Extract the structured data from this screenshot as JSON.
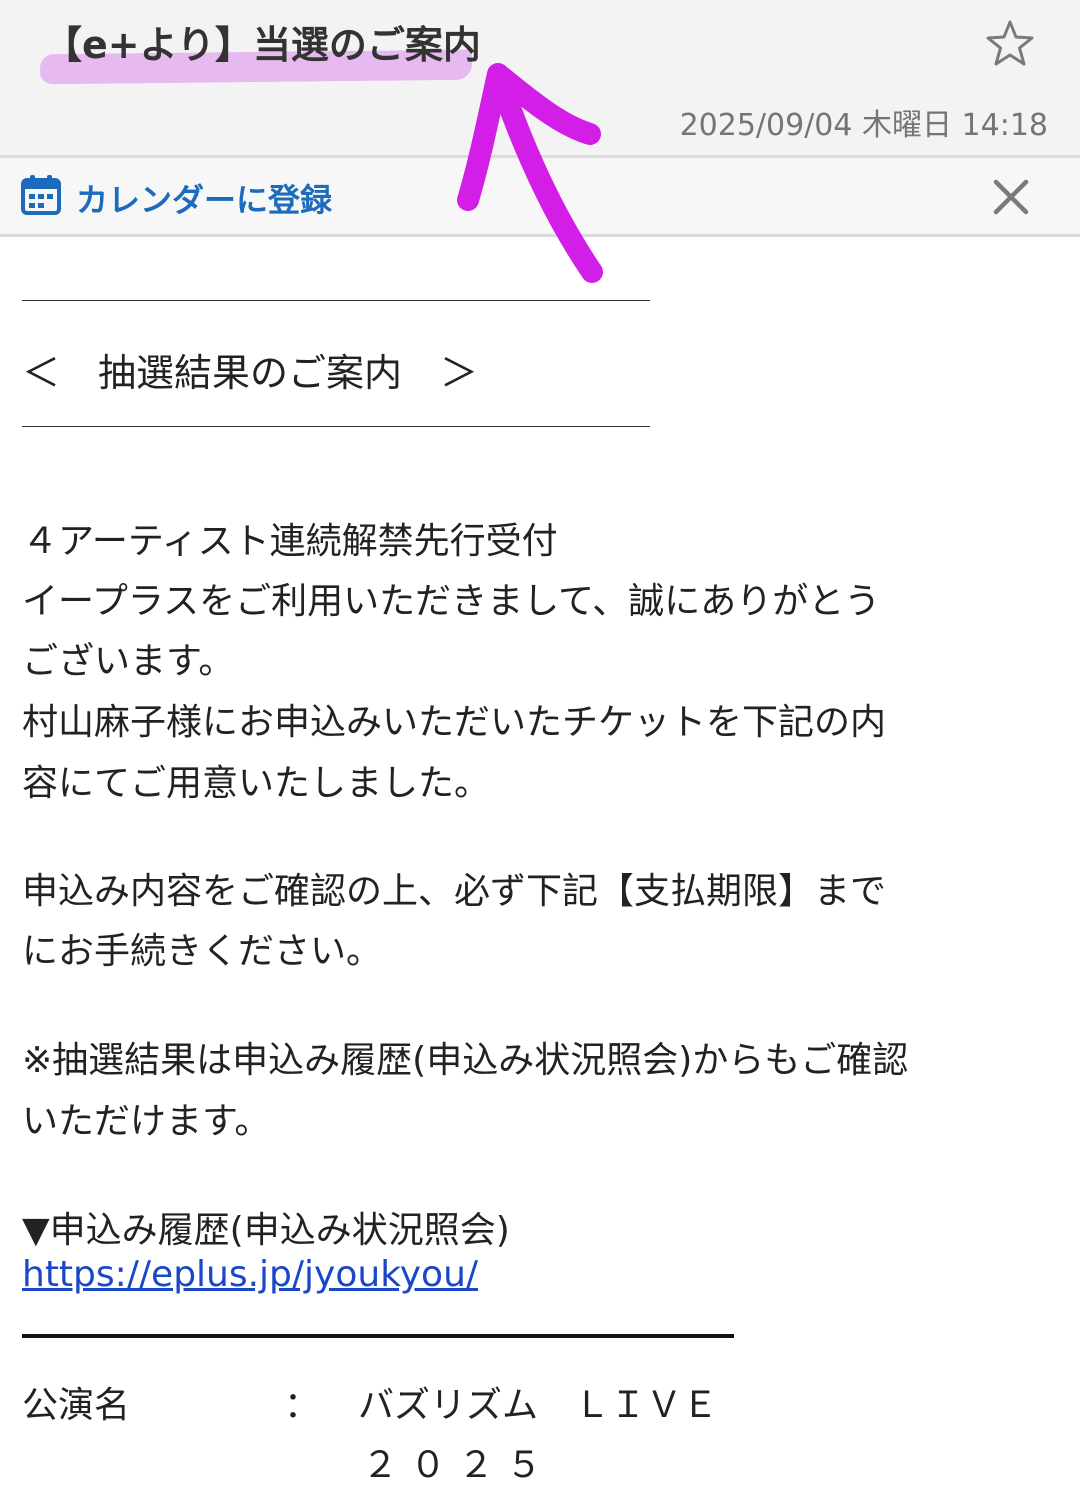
{
  "header": {
    "subject": "【e+より】当選のご案内",
    "datetime": "2025/09/04 木曜日 14:18",
    "star_icon": "star-outline-icon"
  },
  "calendar_bar": {
    "label": "カレンダーに登録",
    "icon": "calendar-icon",
    "close_icon": "close-icon"
  },
  "annotation": {
    "color": "#d21ee6",
    "shape": "hand-drawn-arrow-and-highlight"
  },
  "body": {
    "title": "＜　抽選結果のご案内　＞",
    "paragraphs": [
      "４アーティスト連続解禁先行受付",
      "イープラスをご利用いただきまして、誠にありがとう",
      "ございます。",
      "村山麻子様にお申込みいただいたチケットを下記の内",
      "容にてご用意いたしました。",
      "申込み内容をご確認の上、必ず下記【支払期限】まで",
      "にお手続きください。",
      "※抽選結果は申込み履歴(申込み状況照会)からもご確認",
      "いただけます。",
      "▼申込み履歴(申込み状況照会)"
    ],
    "link": "https://eplus.jp/jyoukyou/",
    "performance": {
      "label": "公演名",
      "colon": "：",
      "value_line1": "バズリズム　ＬＩＶＥ",
      "value_line2": "２０２５"
    }
  },
  "colors": {
    "link": "#1a47c8",
    "calendar_accent": "#1c6bbd",
    "header_bg": "#f3f3f3",
    "highlight": "#e3a6f0"
  }
}
